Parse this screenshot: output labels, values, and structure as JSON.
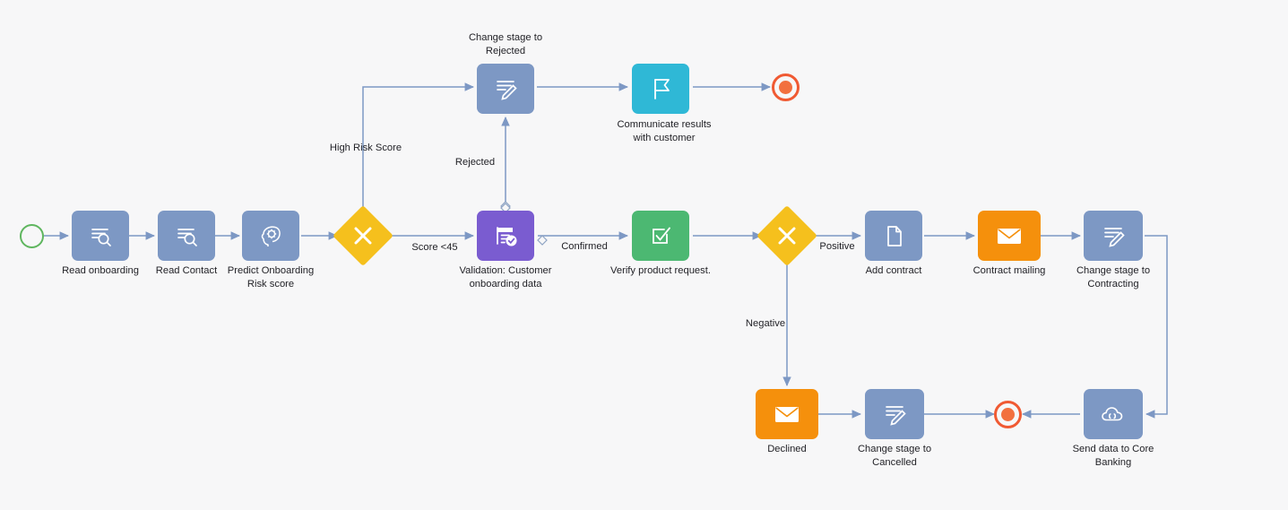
{
  "diagram": {
    "type": "bpmn-workflow",
    "background_color": "#f7f7f8",
    "palette": {
      "task_blue": "#7d98c4",
      "task_purple": "#7a5cd0",
      "task_green": "#4cb872",
      "task_cyan": "#2fb8d6",
      "task_orange": "#f5900c",
      "gateway_yellow": "#f5c01d",
      "start_green": "#5fb65f",
      "end_orange": "#f05a33",
      "connector_blue": "#7d98c4",
      "text_dark": "#222227"
    },
    "nodes": [
      {
        "id": "start",
        "kind": "start-event",
        "label": ""
      },
      {
        "id": "read_onb",
        "kind": "task",
        "color": "task_blue",
        "icon": "document-search-icon",
        "label": "Read onboarding"
      },
      {
        "id": "read_contact",
        "kind": "task",
        "color": "task_blue",
        "icon": "document-search-icon",
        "label": "Read Contact"
      },
      {
        "id": "predict",
        "kind": "task",
        "color": "task_blue",
        "icon": "brain-gears-icon",
        "label": "Predict Onboarding\nRisk score"
      },
      {
        "id": "gw_risk",
        "kind": "gateway",
        "label": ""
      },
      {
        "id": "validation",
        "kind": "task",
        "color": "task_purple",
        "icon": "form-check-icon",
        "label": "Validation: Customer\nonboarding data"
      },
      {
        "id": "verify",
        "kind": "task",
        "color": "task_green",
        "icon": "checkbox-check-icon",
        "label": "Verify product request."
      },
      {
        "id": "gw_result",
        "kind": "gateway",
        "label": ""
      },
      {
        "id": "chg_rejected",
        "kind": "task",
        "color": "task_blue",
        "icon": "edit-pencil-icon",
        "label": "Change stage to\nRejected"
      },
      {
        "id": "communicate",
        "kind": "task",
        "color": "task_cyan",
        "icon": "flag-icon",
        "label": "Communicate results\nwith customer"
      },
      {
        "id": "end_top",
        "kind": "end-event",
        "label": ""
      },
      {
        "id": "add_contract",
        "kind": "task",
        "color": "task_blue",
        "icon": "file-icon",
        "label": "Add contract"
      },
      {
        "id": "contract_mail",
        "kind": "task",
        "color": "task_orange",
        "icon": "envelope-icon",
        "label": "Contract mailing"
      },
      {
        "id": "chg_contracting",
        "kind": "task",
        "color": "task_blue",
        "icon": "edit-pencil-icon",
        "label": "Change stage to\nContracting"
      },
      {
        "id": "declined",
        "kind": "task",
        "color": "task_orange",
        "icon": "envelope-icon",
        "label": "Declined"
      },
      {
        "id": "chg_cancelled",
        "kind": "task",
        "color": "task_blue",
        "icon": "edit-pencil-icon",
        "label": "Change stage to\nCancelled"
      },
      {
        "id": "end_bottom",
        "kind": "end-event",
        "label": ""
      },
      {
        "id": "send_core",
        "kind": "task",
        "color": "task_blue",
        "icon": "cloud-api-icon",
        "label": "Send data to Core\nBanking"
      }
    ],
    "edge_labels": {
      "high_risk": "High Risk Score",
      "rejected": "Rejected",
      "score_lt45": "Score <45",
      "confirmed": "Confirmed",
      "positive": "Positive",
      "negative": "Negative"
    },
    "edges": [
      {
        "from": "start",
        "to": "read_onb",
        "label": ""
      },
      {
        "from": "read_onb",
        "to": "read_contact",
        "label": ""
      },
      {
        "from": "read_contact",
        "to": "predict",
        "label": ""
      },
      {
        "from": "predict",
        "to": "gw_risk",
        "label": ""
      },
      {
        "from": "gw_risk",
        "to": "chg_rejected",
        "label": "High Risk Score"
      },
      {
        "from": "gw_risk",
        "to": "validation",
        "label": "Score <45"
      },
      {
        "from": "validation",
        "to": "chg_rejected",
        "label": "Rejected"
      },
      {
        "from": "validation",
        "to": "verify",
        "label": "Confirmed"
      },
      {
        "from": "verify",
        "to": "gw_result",
        "label": ""
      },
      {
        "from": "chg_rejected",
        "to": "communicate",
        "label": ""
      },
      {
        "from": "communicate",
        "to": "end_top",
        "label": ""
      },
      {
        "from": "gw_result",
        "to": "add_contract",
        "label": "Positive"
      },
      {
        "from": "gw_result",
        "to": "declined",
        "label": "Negative"
      },
      {
        "from": "add_contract",
        "to": "contract_mail",
        "label": ""
      },
      {
        "from": "contract_mail",
        "to": "chg_contracting",
        "label": ""
      },
      {
        "from": "chg_contracting",
        "to": "send_core",
        "label": ""
      },
      {
        "from": "send_core",
        "to": "end_bottom",
        "label": ""
      },
      {
        "from": "declined",
        "to": "chg_cancelled",
        "label": ""
      },
      {
        "from": "chg_cancelled",
        "to": "end_bottom",
        "label": ""
      }
    ]
  }
}
